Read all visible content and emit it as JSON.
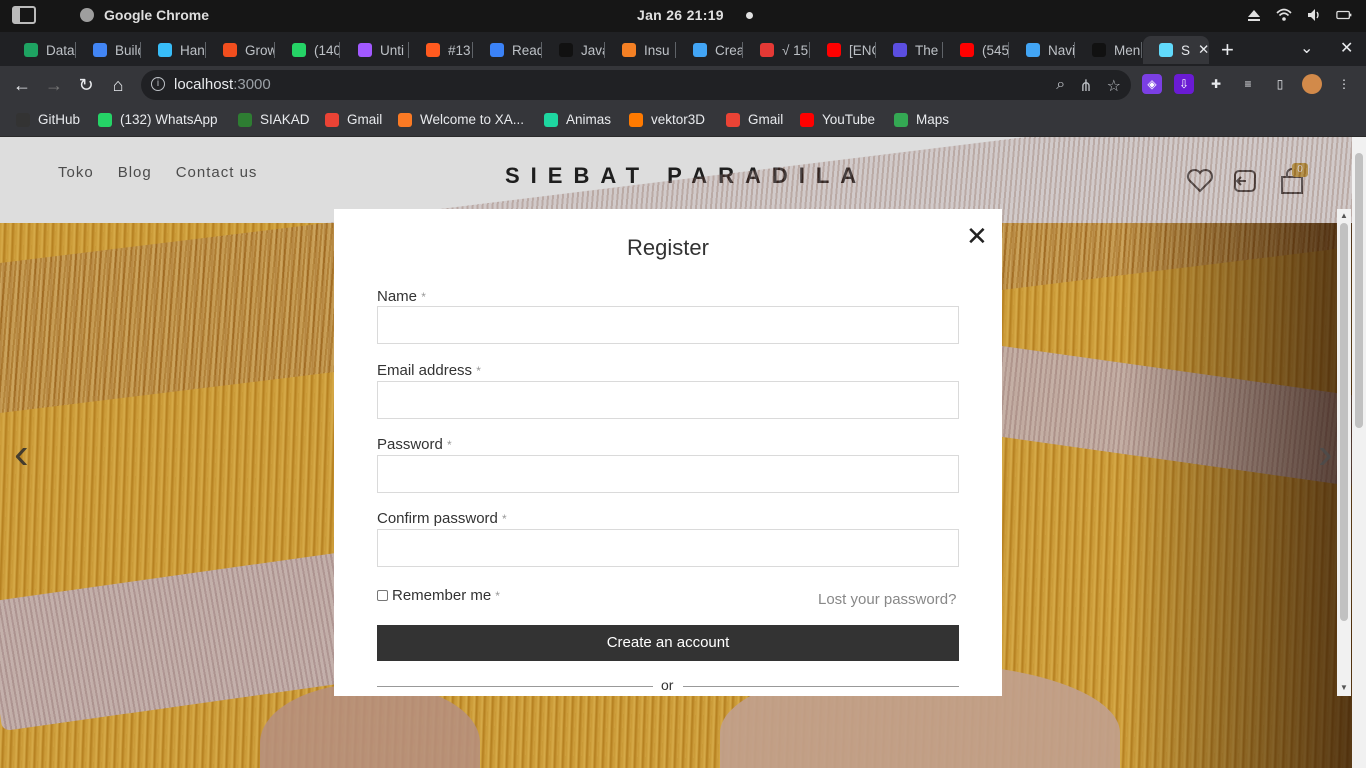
{
  "os": {
    "app_name": "Google Chrome",
    "clock": "Jan 26  21:19"
  },
  "tabs": [
    {
      "label": "Data",
      "color": "#1ea362"
    },
    {
      "label": "Build",
      "color": "#4285f4"
    },
    {
      "label": "Hand",
      "color": "#38bdf8"
    },
    {
      "label": "Grow",
      "color": "#f24e1e"
    },
    {
      "label": "(140",
      "color": "#25d366"
    },
    {
      "label": "Unti",
      "color": "#a259ff"
    },
    {
      "label": "#13",
      "color": "#ff5a1f"
    },
    {
      "label": "Read",
      "color": "#3b82f6"
    },
    {
      "label": "Java",
      "color": "#111111"
    },
    {
      "label": "Insu",
      "color": "#f48024"
    },
    {
      "label": "Crea",
      "color": "#42a5f5"
    },
    {
      "label": "√ 15",
      "color": "#e53935"
    },
    {
      "label": "[ENG",
      "color": "#ff0000"
    },
    {
      "label": "The",
      "color": "#5b4ee0"
    },
    {
      "label": "(545",
      "color": "#ff0000"
    },
    {
      "label": "Navi",
      "color": "#42a5f5"
    },
    {
      "label": "Men",
      "color": "#111111"
    },
    {
      "label": "S",
      "color": "#61dafb",
      "active": true
    }
  ],
  "toolbar": {
    "url_host": "localhost",
    "url_port": ":3000"
  },
  "bookmarks": [
    {
      "label": "GitHub",
      "color": "#333333"
    },
    {
      "label": "(132) WhatsApp",
      "color": "#25d366"
    },
    {
      "label": "SIAKAD",
      "color": "#2e7d32"
    },
    {
      "label": "Gmail",
      "color": "#ea4335"
    },
    {
      "label": "Welcome to XA...",
      "color": "#fb7a24"
    },
    {
      "label": "Animas",
      "color": "#1ed6a0"
    },
    {
      "label": "vektor3D",
      "color": "#ff7a00"
    },
    {
      "label": "Gmail",
      "color": "#ea4335"
    },
    {
      "label": "YouTube",
      "color": "#ff0000"
    },
    {
      "label": "Maps",
      "color": "#34a853"
    }
  ],
  "site": {
    "nav": [
      "Toko",
      "Blog",
      "Contact us"
    ],
    "logo": "SIEBAT PARADILA",
    "cart_count": "0"
  },
  "modal": {
    "title": "Register",
    "fields": [
      {
        "label": "Name",
        "required": "*"
      },
      {
        "label": "Email address",
        "required": "*"
      },
      {
        "label": "Password",
        "required": "*"
      },
      {
        "label": "Confirm password",
        "required": "*"
      }
    ],
    "remember_label": "Remember me",
    "remember_required": "*",
    "lost_password": "Lost your password?",
    "create_button": "Create an account",
    "or_text": "or"
  }
}
